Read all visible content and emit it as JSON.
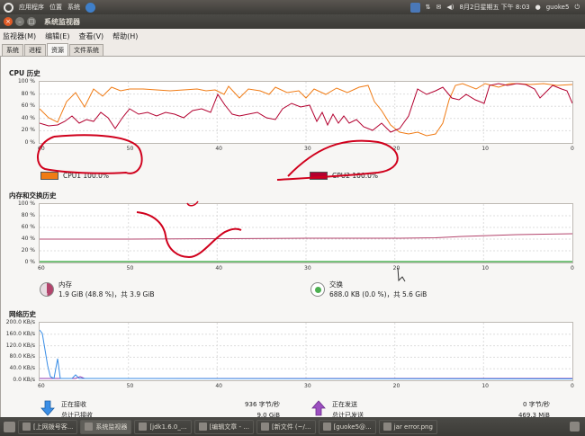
{
  "top_panel": {
    "menus": [
      "应用程序",
      "位置",
      "系统"
    ],
    "datetime": "8月2日星期五 下午  8:03",
    "user": "guoke5"
  },
  "window": {
    "title": "系统监视器",
    "menubar": [
      "监视器(M)",
      "编辑(E)",
      "查看(V)",
      "帮助(H)"
    ],
    "tabs": [
      "系统",
      "进程",
      "资源",
      "文件系统"
    ],
    "active_tab": "资源"
  },
  "cpu": {
    "title": "CPU 历史",
    "y_ticks": [
      "100 %",
      "80 %",
      "60 %",
      "40 %",
      "20 %",
      "0 %"
    ],
    "x_ticks": [
      "60",
      "50",
      "40",
      "30",
      "20",
      "10",
      "0"
    ],
    "legend": [
      {
        "label": "CPU1  100.0%",
        "color": "#f07b14"
      },
      {
        "label": "CPU2  100.0%",
        "color": "#b3002f"
      }
    ]
  },
  "memory": {
    "title": "内存和交换历史",
    "y_ticks": [
      "100 %",
      "80 %",
      "60 %",
      "40 %",
      "20 %",
      "0 %"
    ],
    "x_ticks": [
      "60",
      "50",
      "40",
      "30",
      "20",
      "10",
      "0"
    ],
    "mem_label": "内存",
    "mem_value": "1.9 GiB (48.8 %)，共 3.9 GiB",
    "swap_label": "交换",
    "swap_value": "688.0 KB (0.0 %)，共 5.6 GiB"
  },
  "network": {
    "title": "网络历史",
    "y_ticks": [
      "200.0 KB/s",
      "160.0 KB/s",
      "120.0 KB/s",
      "80.0 KB/s",
      "40.0 KB/s",
      "0.0 KB/s"
    ],
    "x_ticks": [
      "60",
      "50",
      "40",
      "30",
      "20",
      "10",
      "0"
    ],
    "recv_label": "正在接收",
    "recv_total_label": "总计已接收",
    "recv_rate": "936 字节/秒",
    "recv_total": "9.0 GiB",
    "send_label": "正在发送",
    "send_total_label": "总计已发送",
    "send_rate": "0 字节/秒",
    "send_total": "469.3 MiB"
  },
  "taskbar": [
    {
      "label": "[上网拨号客...",
      "active": false
    },
    {
      "label": "系统监视器",
      "active": true
    },
    {
      "label": "[jdk1.6.0_...",
      "active": false
    },
    {
      "label": "[编辑文章 - ...",
      "active": false
    },
    {
      "label": "[新文件 (~/...",
      "active": false
    },
    {
      "label": "[guoke5@...",
      "active": false
    },
    {
      "label": "jar error.png",
      "active": false
    }
  ],
  "colors": {
    "cpu1": "#f07b14",
    "cpu2": "#b3002f",
    "memory": "#b3446c",
    "swap": "#4caf50",
    "net_recv": "#3a8ee6",
    "net_send": "#8e3ab0",
    "annotation": "#d0001c"
  }
}
